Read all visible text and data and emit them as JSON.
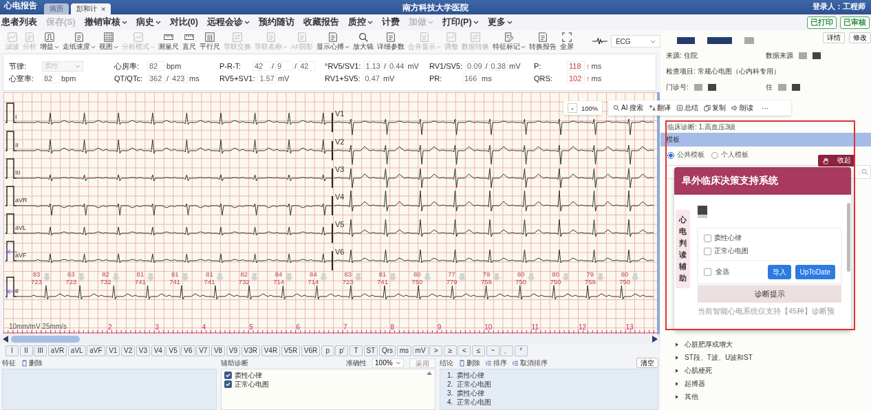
{
  "title_bar": {
    "app_name": "心电报告",
    "tabs": [
      {
        "label": "病历",
        "selected": false
      },
      {
        "label": "彭和计",
        "selected": true,
        "close": "×"
      }
    ],
    "hospital": "南方科技大学医院",
    "user": "登录人：工程师"
  },
  "menu": [
    {
      "label": "患者列表",
      "disabled": false,
      "dropdown": false
    },
    {
      "label": "保存(S)",
      "disabled": true,
      "dropdown": false
    },
    {
      "label": "撤销审核",
      "disabled": false,
      "dropdown": true
    },
    {
      "label": "病史",
      "disabled": false,
      "dropdown": true
    },
    {
      "label": "对比(0)",
      "disabled": false,
      "dropdown": false
    },
    {
      "label": "远程会诊",
      "disabled": false,
      "dropdown": true
    },
    {
      "label": "预约随访",
      "disabled": false,
      "dropdown": false
    },
    {
      "label": "收藏报告",
      "disabled": false,
      "dropdown": false
    },
    {
      "label": "质控",
      "disabled": false,
      "dropdown": true
    },
    {
      "label": "计费",
      "disabled": false,
      "dropdown": false
    },
    {
      "label": "加做",
      "disabled": true,
      "dropdown": true
    },
    {
      "label": "打印(P)",
      "disabled": false,
      "dropdown": true
    },
    {
      "label": "更多",
      "disabled": false,
      "dropdown": true
    }
  ],
  "status_buttons": [
    "已打印",
    "已审核"
  ],
  "toolbar": [
    {
      "label": "滤波",
      "disabled": true,
      "dropdown": false
    },
    {
      "label": "分析",
      "disabled": true,
      "dropdown": false
    },
    {
      "label": "增益",
      "disabled": false,
      "dropdown": true
    },
    {
      "label": "走纸速度",
      "disabled": false,
      "dropdown": true
    },
    {
      "label": "视图",
      "disabled": false,
      "dropdown": true
    },
    {
      "label": "分析模式",
      "disabled": true,
      "dropdown": true
    },
    {
      "label": "测量尺",
      "disabled": false,
      "dropdown": false
    },
    {
      "label": "直尺",
      "disabled": false,
      "dropdown": false
    },
    {
      "label": "平行尺",
      "disabled": false,
      "dropdown": false
    },
    {
      "label": "导联交换",
      "disabled": true,
      "dropdown": false
    },
    {
      "label": "导联名称",
      "disabled": true,
      "dropdown": true
    },
    {
      "label": "AF阴影",
      "disabled": true,
      "dropdown": false
    },
    {
      "label": "显示心搏",
      "disabled": false,
      "dropdown": true
    },
    {
      "label": "放大镜",
      "disabled": false,
      "dropdown": false
    },
    {
      "label": "详细参数",
      "disabled": false,
      "dropdown": false
    },
    {
      "label": "合并显示",
      "disabled": true,
      "dropdown": true
    },
    {
      "label": "调整",
      "disabled": true,
      "dropdown": false
    },
    {
      "label": "数据转换",
      "disabled": true,
      "dropdown": false
    },
    {
      "label": "特征标记",
      "disabled": false,
      "dropdown": true
    },
    {
      "label": "转换报告",
      "disabled": false,
      "dropdown": false
    },
    {
      "label": "全屏",
      "disabled": false,
      "dropdown": false
    }
  ],
  "signal_selector": {
    "value": "ECG"
  },
  "measurements": [
    {
      "label": "节律:",
      "kind": "select",
      "values": [
        "窦性"
      ],
      "disabled": true
    },
    {
      "label": "心房率:",
      "kind": "values",
      "values": [
        "82"
      ],
      "unit": "bpm"
    },
    {
      "label": "P-R-T:",
      "kind": "values",
      "values": [
        "42",
        "9",
        "42"
      ],
      "separator": "/"
    },
    {
      "label": "°RV5/SV1:",
      "kind": "values",
      "values": [
        "1.13",
        "0.44"
      ],
      "separator": "/",
      "unit": "mV"
    },
    {
      "label": "RV1/SV5:",
      "kind": "values",
      "values": [
        "0.09",
        "0.38"
      ],
      "separator": "/",
      "unit": "mV"
    },
    {
      "label": "P:",
      "kind": "values",
      "values": [
        "118"
      ],
      "alert": "↑",
      "unit": "ms"
    },
    {
      "label": "心室率:",
      "kind": "values",
      "values": [
        "82"
      ],
      "unit": "bpm"
    },
    {
      "label": "QT/QTc:",
      "kind": "values",
      "values": [
        "362",
        "423"
      ],
      "separator": "/",
      "unit": "ms"
    },
    {
      "label": "RV5+SV1:",
      "kind": "values",
      "values": [
        "1.57"
      ],
      "unit": "mV"
    },
    {
      "label": "RV1+SV5:",
      "kind": "values",
      "values": [
        "0.47"
      ],
      "unit": "mV"
    },
    {
      "label": "PR:",
      "kind": "values",
      "values": [
        "166"
      ],
      "unit": "ms"
    },
    {
      "label": "QRS:",
      "kind": "values",
      "values": [
        "102"
      ],
      "alert": "↑",
      "unit": "ms"
    }
  ],
  "ecg": {
    "leads_left": [
      "I",
      "II",
      "III",
      "aVR",
      "aVL",
      "aVF"
    ],
    "leads_right": [
      "V1",
      "V2",
      "V3",
      "V4",
      "V5",
      "V6"
    ],
    "rhythm_lead": "II",
    "beats": [
      {
        "rate": "83",
        "rr": "723"
      },
      {
        "rate": "83",
        "rr": "723"
      },
      {
        "rate": "82",
        "rr": "732"
      },
      {
        "rate": "81",
        "rr": "741"
      },
      {
        "rate": "81",
        "rr": "741"
      },
      {
        "rate": "81",
        "rr": "741"
      },
      {
        "rate": "82",
        "rr": "732"
      },
      {
        "rate": "84",
        "rr": "714"
      },
      {
        "rate": "84",
        "rr": "714"
      },
      {
        "rate": "83",
        "rr": "723"
      },
      {
        "rate": "81",
        "rr": "741"
      },
      {
        "rate": "80",
        "rr": "750"
      },
      {
        "rate": "77",
        "rr": "779"
      },
      {
        "rate": "79",
        "rr": "759"
      },
      {
        "rate": "80",
        "rr": "750"
      },
      {
        "rate": "80",
        "rr": "750"
      },
      {
        "rate": "79",
        "rr": "759"
      },
      {
        "rate": "80",
        "rr": "750"
      }
    ],
    "scale": "10mm/mV 25mm/s",
    "time_marks": [
      "2",
      "3",
      "4",
      "5",
      "6",
      "7",
      "8",
      "9",
      "10",
      "11",
      "12",
      "13"
    ]
  },
  "lead_buttons": [
    "I",
    "II",
    "III",
    "aVR",
    "aVL",
    "aVF",
    "V1",
    "V2",
    "V3",
    "V4",
    "V5",
    "V6",
    "V7",
    "V8",
    "V9",
    "V3R",
    "V4R",
    "V5R",
    "V6R",
    "p",
    "p'",
    "T",
    "ST",
    "Qrs",
    "ms",
    "mV",
    ">",
    "≥",
    "<",
    "≤",
    "~",
    "、",
    "°"
  ],
  "features": {
    "title": "特征",
    "delete": "删除"
  },
  "assist": {
    "title": "辅助诊断",
    "accuracy_label": "准确性",
    "accuracy": "100%",
    "adopt": {
      "label": "采用",
      "disabled": true
    },
    "items": [
      {
        "label": "窦性心律",
        "checked": true
      },
      {
        "label": "正常心电图",
        "checked": true
      }
    ]
  },
  "conclusion": {
    "title": "结论",
    "delete": "删除",
    "sort": "排序",
    "unsort": "取消排序",
    "clear": "清空",
    "items": [
      {
        "number": "1.",
        "text": "窦性心律"
      },
      {
        "number": "2.",
        "text": "正常心电图"
      },
      {
        "number": "3.",
        "text": "窦性心律"
      },
      {
        "number": "4.",
        "text": "正常心电图"
      }
    ]
  },
  "side_panel": {
    "buttons": [
      "详情",
      "修改"
    ],
    "info_rows": [
      [
        {
          "label": "来源:",
          "value": "住院"
        },
        {
          "label": "数据来源"
        }
      ],
      [
        {
          "label": "检查项目:",
          "value": "常规心电图（心内科专用）"
        }
      ],
      [
        {
          "label": "门诊号:"
        },
        {
          "label": "住"
        }
      ]
    ],
    "clinical_diagnosis": "临床诊断: 1.高血压3级",
    "template": {
      "title": "模板",
      "options": [
        {
          "label": "公共模板",
          "selected": true
        },
        {
          "label": "个人模板",
          "selected": false
        }
      ]
    },
    "tree": [
      {
        "label": "心脏肥厚或增大",
        "expanded": false
      },
      {
        "label": "ST段、T波、U波和ST",
        "expanded": false
      },
      {
        "label": "心肌梗死",
        "expanded": false
      },
      {
        "label": "起搏器",
        "expanded": false
      },
      {
        "label": "其他",
        "expanded": false
      }
    ]
  },
  "zoom_control": {
    "minus": "-",
    "value": "100%"
  },
  "ai_toolbar": {
    "actions": [
      {
        "kind": "search",
        "label": "AI 搜索"
      },
      {
        "kind": "translate",
        "label": "翻译"
      },
      {
        "kind": "summary",
        "label": "总结"
      },
      {
        "kind": "copy",
        "label": "复制"
      },
      {
        "kind": "read",
        "label": "朗读"
      }
    ],
    "more": "···"
  },
  "decision_popup": {
    "title": "阜外临床决策支持系统",
    "collapse": "收起",
    "side_tab": "心电判读辅助",
    "items": [
      {
        "label": "窦性心律",
        "checked": false
      },
      {
        "label": "正常心电图",
        "checked": false
      }
    ],
    "select_all": {
      "label": "全选",
      "checked": false
    },
    "buttons": [
      "导入",
      "UpToDate"
    ],
    "hint_title": "诊断提示",
    "hint": "当前智能心电系统仅支持【45种】诊断预"
  }
}
